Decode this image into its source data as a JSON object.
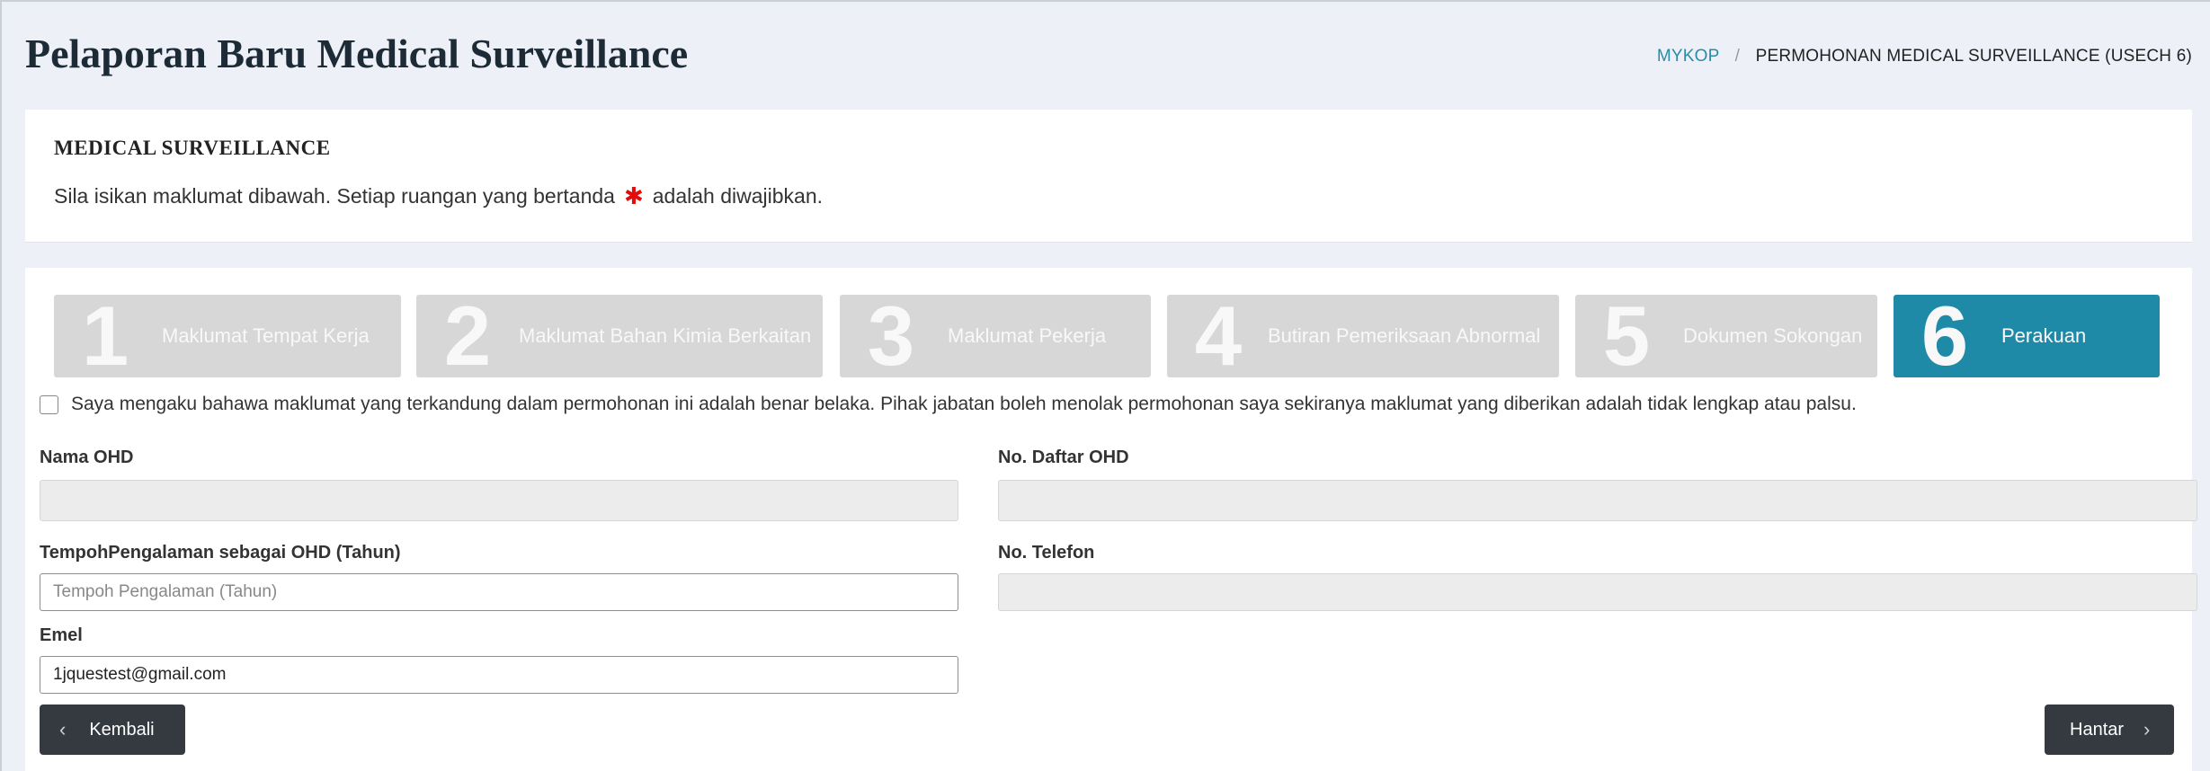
{
  "header": {
    "title": "Pelaporan Baru Medical Surveillance",
    "breadcrumb": {
      "root": "MYKOP",
      "separator": "/",
      "current": "PERMOHONAN MEDICAL SURVEILLANCE (USECH 6)"
    }
  },
  "info": {
    "title": "MEDICAL SURVEILLANCE",
    "text_before": "Sila isikan maklumat dibawah. Setiap ruangan yang bertanda",
    "required_symbol": "✱",
    "text_after": "adalah diwajibkan."
  },
  "steps": [
    {
      "number": "1",
      "label": "Maklumat Tempat Kerja",
      "active": false
    },
    {
      "number": "2",
      "label": "Maklumat Bahan Kimia Berkaitan",
      "active": false
    },
    {
      "number": "3",
      "label": "Maklumat Pekerja",
      "active": false
    },
    {
      "number": "4",
      "label": "Butiran Pemeriksaan Abnormal",
      "active": false
    },
    {
      "number": "5",
      "label": "Dokumen Sokongan",
      "active": false
    },
    {
      "number": "6",
      "label": "Perakuan",
      "active": true
    }
  ],
  "declaration": {
    "checked": false,
    "text": "Saya mengaku bahawa maklumat yang terkandung dalam permohonan ini adalah benar belaka. Pihak jabatan boleh menolak permohonan saya sekiranya maklumat yang diberikan adalah tidak lengkap atau palsu."
  },
  "form": {
    "nama_ohd": {
      "label": "Nama OHD",
      "value": ""
    },
    "no_daftar_ohd": {
      "label": "No. Daftar OHD",
      "value": ""
    },
    "tempoh": {
      "label": "TempohPengalaman sebagai OHD (Tahun)",
      "value": "",
      "placeholder": "Tempoh Pengalaman (Tahun)"
    },
    "no_telefon": {
      "label": "No. Telefon",
      "value": ""
    },
    "emel": {
      "label": "Emel",
      "value": "1jquestest@gmail.com"
    }
  },
  "buttons": {
    "back_label": "Kembali",
    "submit_label": "Hantar"
  },
  "colors": {
    "accent": "#1f8aa8",
    "step_inactive": "#d7d7d7",
    "button_dark": "#343a40",
    "required": "#e10d0d"
  }
}
